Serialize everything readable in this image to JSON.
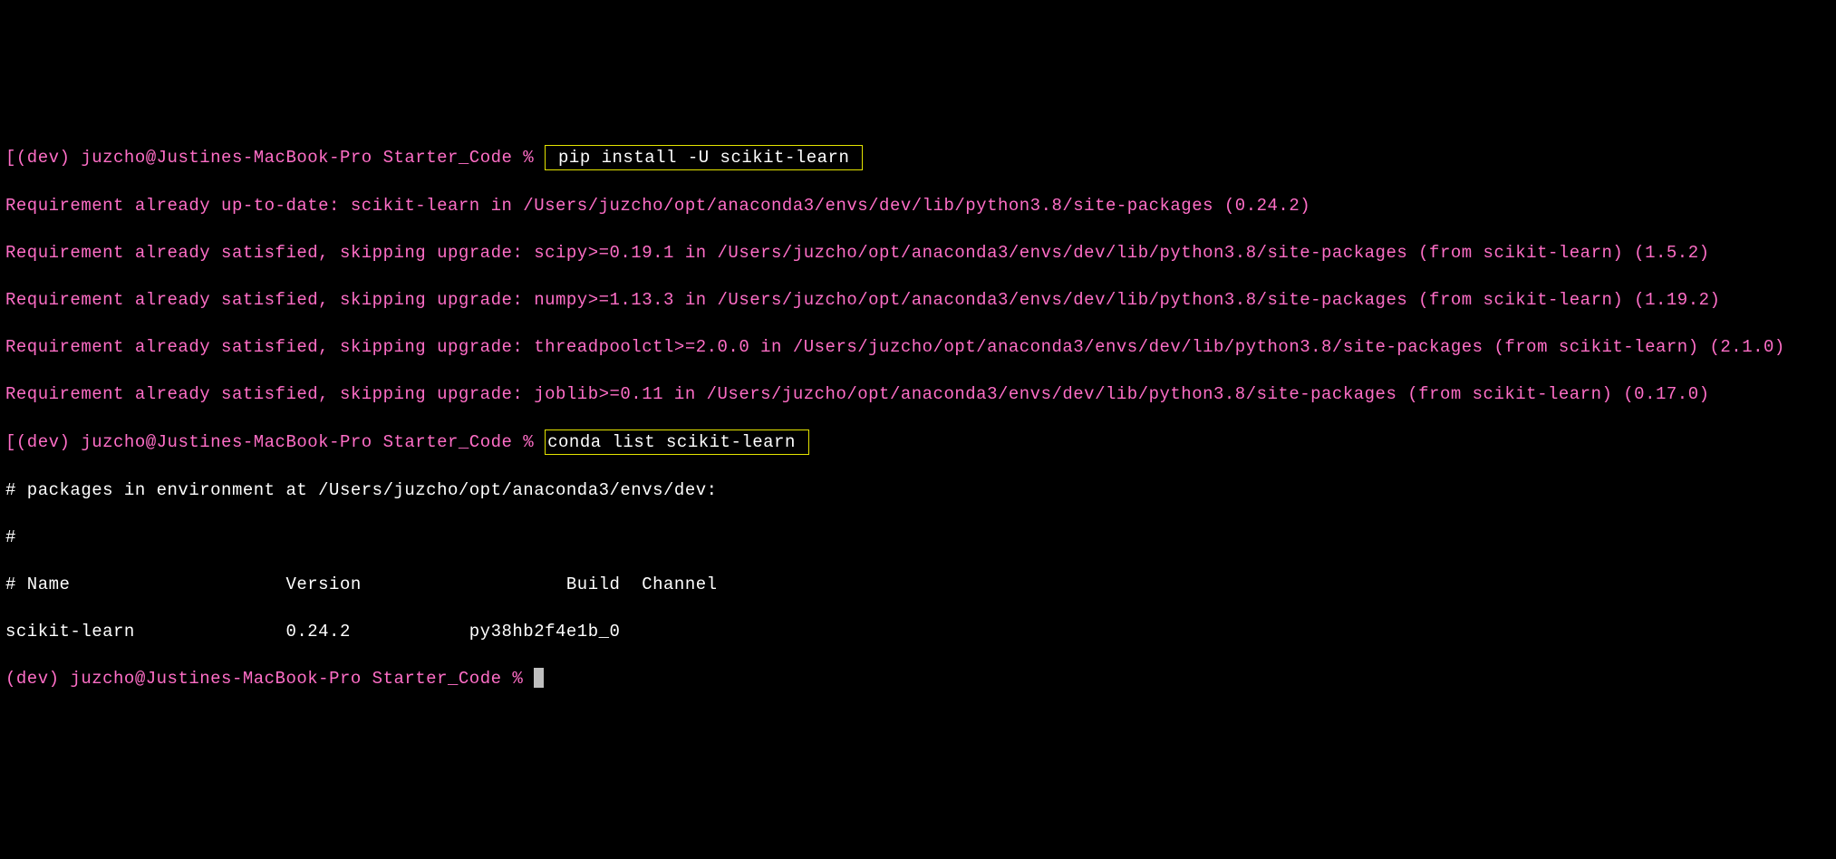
{
  "prompts": {
    "p1_bracket": "[",
    "p1_env": "(dev) ",
    "p1_rest": "juzcho@Justines-MacBook-Pro Starter_Code % ",
    "p2_bracket": "[",
    "p2_env": "(dev) ",
    "p2_rest": "juzcho@Justines-MacBook-Pro Starter_Code % ",
    "p3_env": "(dev) ",
    "p3_rest": "juzcho@Justines-MacBook-Pro Starter_Code % "
  },
  "commands": {
    "cmd1_left": " pip install -U scikit-learn ",
    "cmd2": "conda list scikit-learn "
  },
  "pip_output": {
    "l1": "Requirement already up-to-date: scikit-learn in /Users/juzcho/opt/anaconda3/envs/dev/lib/python3.8/site-packages (0.24.2)",
    "l2": "Requirement already satisfied, skipping upgrade: scipy>=0.19.1 in /Users/juzcho/opt/anaconda3/envs/dev/lib/python3.8/site-packages (from scikit-learn) (1.5.2)",
    "l3": "Requirement already satisfied, skipping upgrade: numpy>=1.13.3 in /Users/juzcho/opt/anaconda3/envs/dev/lib/python3.8/site-packages (from scikit-learn) (1.19.2)",
    "l4": "Requirement already satisfied, skipping upgrade: threadpoolctl>=2.0.0 in /Users/juzcho/opt/anaconda3/envs/dev/lib/python3.8/site-packages (from scikit-learn) (2.1.0)",
    "l5": "Requirement already satisfied, skipping upgrade: joblib>=0.11 in /Users/juzcho/opt/anaconda3/envs/dev/lib/python3.8/site-packages (from scikit-learn) (0.17.0)"
  },
  "conda_output": {
    "hdr1": "# packages in environment at /Users/juzcho/opt/anaconda3/envs/dev:",
    "hdr2": "#",
    "hdr3": "# Name                    Version                   Build  Channel",
    "row1": "scikit-learn              0.24.2           py38hb2f4e1b_0"
  }
}
